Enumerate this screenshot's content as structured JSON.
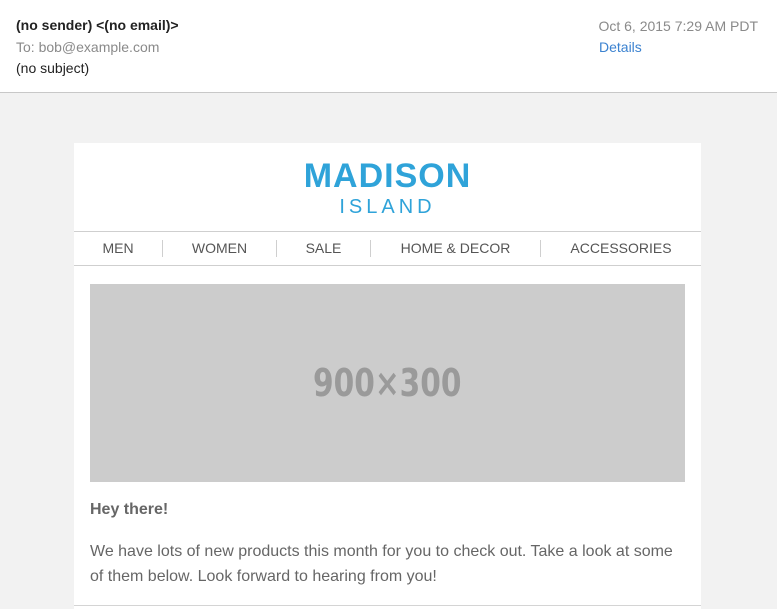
{
  "email": {
    "sender": "(no sender) <(no email)>",
    "to": "To: bob@example.com",
    "subject": "(no subject)",
    "date": "Oct 6, 2015 7:29 AM PDT",
    "details_link": "Details"
  },
  "newsletter": {
    "brand": "MADISON",
    "brand_sub": "ISLAND",
    "brand_color": "#2fa3d9",
    "nav": [
      "MEN",
      "WOMEN",
      "SALE",
      "HOME & DECOR",
      "ACCESSORIES"
    ],
    "hero_placeholder": "900×300",
    "greeting": "Hey there!",
    "body": "We have lots of new products this month for you to check out. Take a look at some of them below. Look forward to hearing from you!"
  },
  "colors": {
    "link": "#3b82d0",
    "background": "#f2f2f2",
    "placeholder": "#cccccc"
  }
}
